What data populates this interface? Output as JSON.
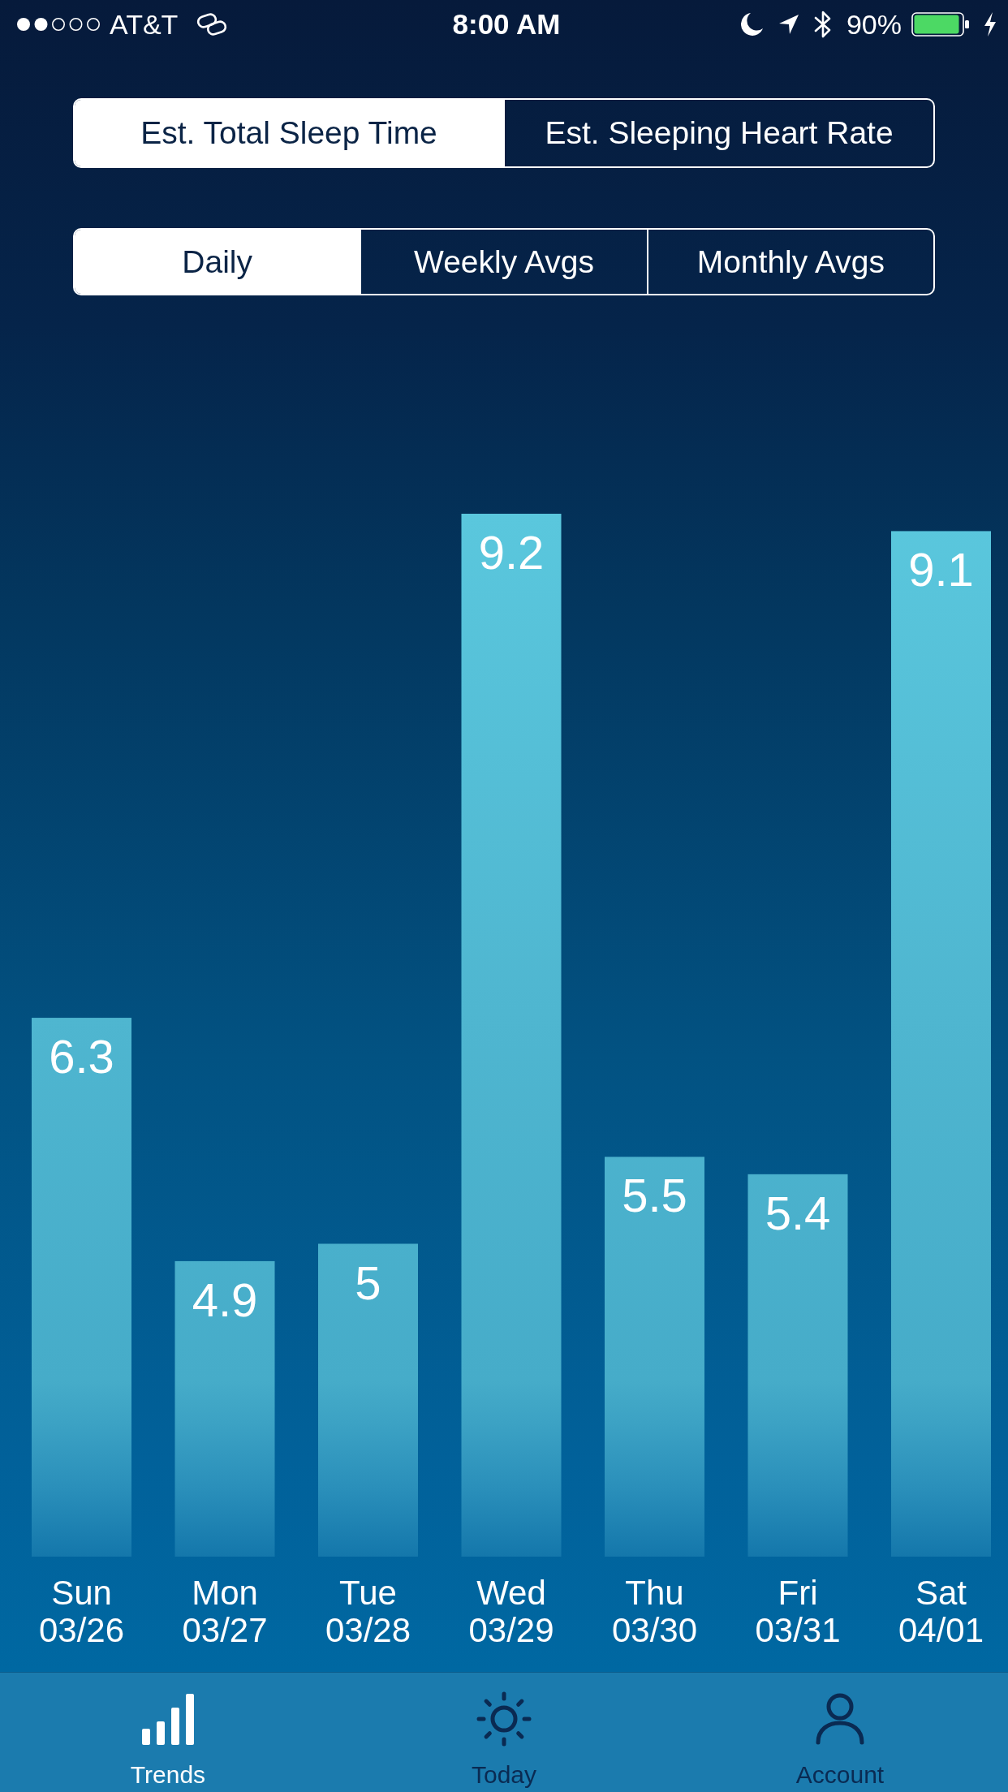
{
  "status_bar": {
    "carrier": "AT&T",
    "time": "8:00 AM",
    "battery": "90%"
  },
  "metric_tabs": [
    {
      "label": "Est. Total Sleep Time",
      "selected": true
    },
    {
      "label": "Est. Sleeping Heart Rate",
      "selected": false
    }
  ],
  "period_tabs": [
    {
      "label": "Daily",
      "selected": true
    },
    {
      "label": "Weekly Avgs",
      "selected": false
    },
    {
      "label": "Monthly Avgs",
      "selected": false
    }
  ],
  "chart": {
    "chart_data": {
      "type": "bar",
      "categories": [
        "Sun 03/26",
        "Mon 03/27",
        "Tue 03/28",
        "Wed 03/29",
        "Thu 03/30",
        "Fri 03/31",
        "Sat 04/01"
      ],
      "values": [
        6.3,
        4.9,
        5,
        9.2,
        5.5,
        5.4,
        9.1
      ],
      "ylim": [
        3.2,
        9.2
      ],
      "data_labels": true
    }
  },
  "tab_bar": [
    {
      "label": "Trends",
      "selected": true
    },
    {
      "label": "Today",
      "selected": false
    },
    {
      "label": "Account",
      "selected": false
    }
  ]
}
